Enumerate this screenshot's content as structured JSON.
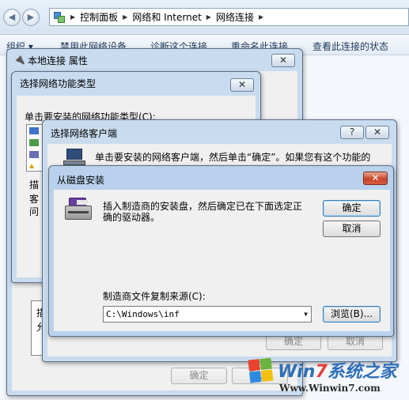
{
  "explorer": {
    "breadcrumb": [
      "控制面板",
      "网络和 Internet",
      "网络连接"
    ],
    "commands": [
      "组织 ▾",
      "禁用此网络设备",
      "诊断这个连接",
      "重命名此连接",
      "查看此连接的状态"
    ]
  },
  "props_window": {
    "title": "本地连接 属性",
    "close_label": "✕",
    "ok_label": "确定",
    "cancel_label": "取消",
    "left_labels": [
      "描",
      "允"
    ]
  },
  "feature_window": {
    "title": "选择网络功能类型",
    "close_label": "✕",
    "prompt": "单击要安装的网络功能类型(C):",
    "left_labels": [
      "描",
      "客",
      "问"
    ]
  },
  "client_window": {
    "title": "选择网络客户端",
    "help_label": "?",
    "close_label": "✕",
    "instruction": "单击要安装的网络客户端，然后单击“确定”。如果您有这个功能的",
    "ok_label": "确定",
    "cancel_label": "取消"
  },
  "disk_window": {
    "title": "从磁盘安装",
    "close_label": "✕",
    "message_line1": "插入制造商的安装盘，然后确定已在下面选定正",
    "message_line2": "确的驱动器。",
    "ok_label": "确定",
    "cancel_label": "取消",
    "copy_from_label": "制造商文件复制来源(C):",
    "copy_from_value": "C:\\Windows\\inf",
    "browse_label": "浏览(B)..."
  },
  "watermark": {
    "title_a": "Win",
    "title_b": "7",
    "title_c": "系统之家",
    "url": "Www.Winwin7.com"
  },
  "colors": {
    "title_blue": "#1e395b",
    "close_red": "#c7452a",
    "watermark_blue": "#2f6fb8",
    "watermark_red": "#e0423a"
  }
}
